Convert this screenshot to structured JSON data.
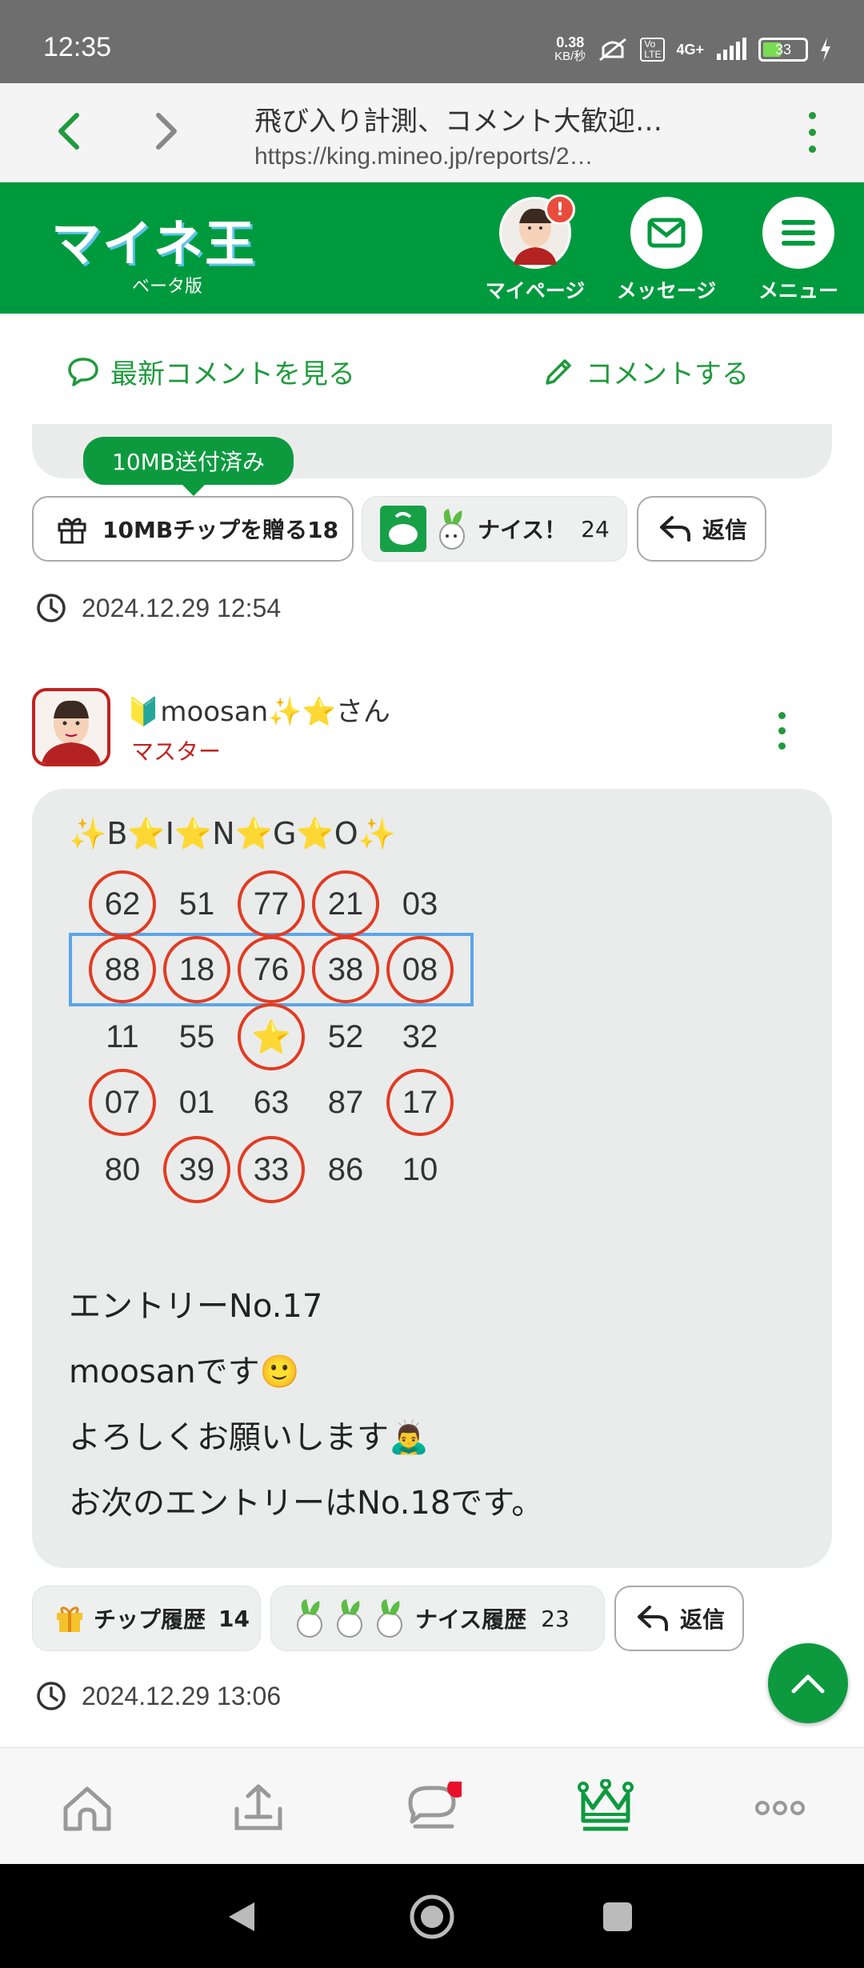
{
  "status": {
    "time": "12:35",
    "net_speed_top": "0.38",
    "net_speed_unit": "KB/秒",
    "network": "4G+",
    "battery": "33"
  },
  "browser": {
    "title": "飛び入り計測、コメント大歓迎…",
    "url": "https://king.mineo.jp/reports/2…"
  },
  "header": {
    "logo": "マイネ王",
    "beta": "ベータ版",
    "mypage": "マイページ",
    "message": "メッセージ",
    "menu": "メニュー",
    "notif": "!"
  },
  "actions": {
    "latest_comments": "最新コメントを見る",
    "comment": "コメントする"
  },
  "prev_post": {
    "tooltip": "10MB送付済み",
    "tip_button": "10MBチップを贈る18",
    "nice_label": "ナイス！",
    "nice_count": "24",
    "reply": "返信",
    "timestamp": "2024.12.29 12:54"
  },
  "post": {
    "username": "🔰moosan✨⭐さん",
    "rank": "マスター",
    "bingo_title": "✨B⭐I⭐N⭐G⭐O✨",
    "grid": [
      [
        {
          "v": "62",
          "m": true
        },
        {
          "v": "51",
          "m": false
        },
        {
          "v": "77",
          "m": true
        },
        {
          "v": "21",
          "m": true
        },
        {
          "v": "03",
          "m": false
        }
      ],
      [
        {
          "v": "88",
          "m": true
        },
        {
          "v": "18",
          "m": true
        },
        {
          "v": "76",
          "m": true
        },
        {
          "v": "38",
          "m": true
        },
        {
          "v": "08",
          "m": true
        }
      ],
      [
        {
          "v": "11",
          "m": false
        },
        {
          "v": "55",
          "m": false
        },
        {
          "v": "⭐",
          "m": true
        },
        {
          "v": "52",
          "m": false
        },
        {
          "v": "32",
          "m": false
        }
      ],
      [
        {
          "v": "07",
          "m": true
        },
        {
          "v": "01",
          "m": false
        },
        {
          "v": "63",
          "m": false
        },
        {
          "v": "87",
          "m": false
        },
        {
          "v": "17",
          "m": true
        }
      ],
      [
        {
          "v": "80",
          "m": false
        },
        {
          "v": "39",
          "m": true
        },
        {
          "v": "33",
          "m": true
        },
        {
          "v": "86",
          "m": false
        },
        {
          "v": "10",
          "m": false
        }
      ]
    ],
    "lines": [
      "エントリーNo.17",
      "moosanです🙂",
      "よろしくお願いします🙇‍♂️",
      "お次のエントリーはNo.18です。"
    ],
    "tip_history": "チップ履歴",
    "tip_count": "14",
    "nice_history": "ナイス履歴",
    "nice_count": "23",
    "reply": "返信",
    "timestamp": "2024.12.29 13:06"
  },
  "colors": {
    "brand_green": "#009a3e",
    "mark_red": "#e23b22",
    "highlight_blue": "#5aa6ea",
    "rank_red": "#c0221f"
  }
}
